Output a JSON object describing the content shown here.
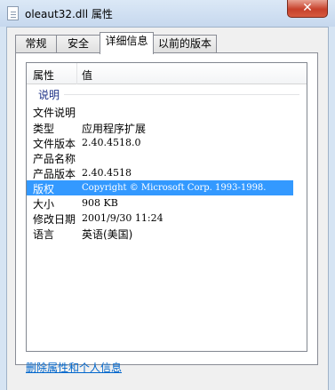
{
  "window": {
    "title": "oleaut32.dll 属性",
    "close_label": "✕"
  },
  "tabs": [
    {
      "label": "常规"
    },
    {
      "label": "安全"
    },
    {
      "label": "详细信息"
    },
    {
      "label": "以前的版本"
    }
  ],
  "active_tab": "详细信息",
  "list": {
    "columns": {
      "property": "属性",
      "value": "值"
    },
    "group": "说明",
    "rows": [
      {
        "property": "文件说明",
        "value": ""
      },
      {
        "property": "类型",
        "value": "应用程序扩展"
      },
      {
        "property": "文件版本",
        "value": "2.40.4518.0"
      },
      {
        "property": "产品名称",
        "value": ""
      },
      {
        "property": "产品版本",
        "value": "2.40.4518"
      },
      {
        "property": "版权",
        "value": "Copyright © Microsoft Corp. 1993-1998."
      },
      {
        "property": "大小",
        "value": "908 KB"
      },
      {
        "property": "修改日期",
        "value": "2001/9/30 11:24"
      },
      {
        "property": "语言",
        "value": "英语(美国)"
      }
    ],
    "selected_property": "版权"
  },
  "footer": {
    "link": "删除属性和个人信息"
  }
}
